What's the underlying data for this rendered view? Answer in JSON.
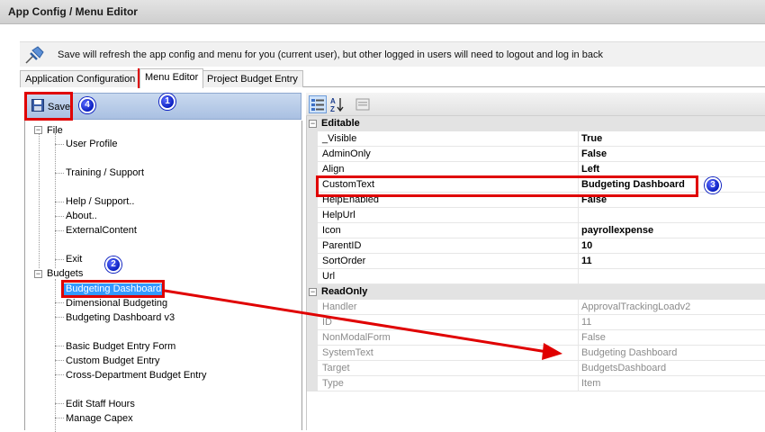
{
  "window": {
    "title": "App Config / Menu Editor"
  },
  "info_bar": {
    "icon": "pushpin-icon",
    "message": "Save will refresh the app config and menu for you (current user), but other logged in users will need to logout and log in back"
  },
  "tabs": [
    {
      "label": "Application Configuration",
      "active": false
    },
    {
      "label": "Menu Editor",
      "active": true
    },
    {
      "label": "Project Budget Entry",
      "active": false
    }
  ],
  "toolbar": {
    "save_label": "Save"
  },
  "tree": {
    "file": {
      "label": "File",
      "children": [
        "User Profile",
        "",
        "Training / Support",
        "",
        "Help / Support..",
        "About..",
        "ExternalContent",
        "",
        "Exit"
      ]
    },
    "budgets": {
      "label": "Budgets",
      "children": [
        "Budgeting Dashboard",
        "Dimensional Budgeting",
        "Budgeting Dashboard v3",
        "",
        "Basic Budget Entry Form",
        "Custom Budget Entry",
        "Cross-Department Budget Entry",
        "",
        "Edit Staff Hours",
        "Manage Capex"
      ]
    }
  },
  "properties": {
    "editable": {
      "label": "Editable",
      "rows": [
        {
          "name": "_Visible",
          "value": "True"
        },
        {
          "name": "AdminOnly",
          "value": "False"
        },
        {
          "name": "Align",
          "value": "Left"
        },
        {
          "name": "CustomText",
          "value": "Budgeting Dashboard"
        },
        {
          "name": "HelpEnabled",
          "value": "False"
        },
        {
          "name": "HelpUrl",
          "value": ""
        },
        {
          "name": "Icon",
          "value": "payrollexpense"
        },
        {
          "name": "ParentID",
          "value": "10"
        },
        {
          "name": "SortOrder",
          "value": "11"
        },
        {
          "name": "Url",
          "value": ""
        }
      ]
    },
    "readonly": {
      "label": "ReadOnly",
      "rows": [
        {
          "name": "Handler",
          "value": "ApprovalTrackingLoadv2"
        },
        {
          "name": "ID",
          "value": "11"
        },
        {
          "name": "NonModalForm",
          "value": "False"
        },
        {
          "name": "SystemText",
          "value": "Budgeting Dashboard"
        },
        {
          "name": "Target",
          "value": "BudgetsDashboard"
        },
        {
          "name": "Type",
          "value": "Item"
        }
      ]
    }
  },
  "annotations": {
    "badges": [
      "1",
      "2",
      "3",
      "4"
    ],
    "highlight_color": "#e00000",
    "badge_color": "#0b1fc0"
  }
}
